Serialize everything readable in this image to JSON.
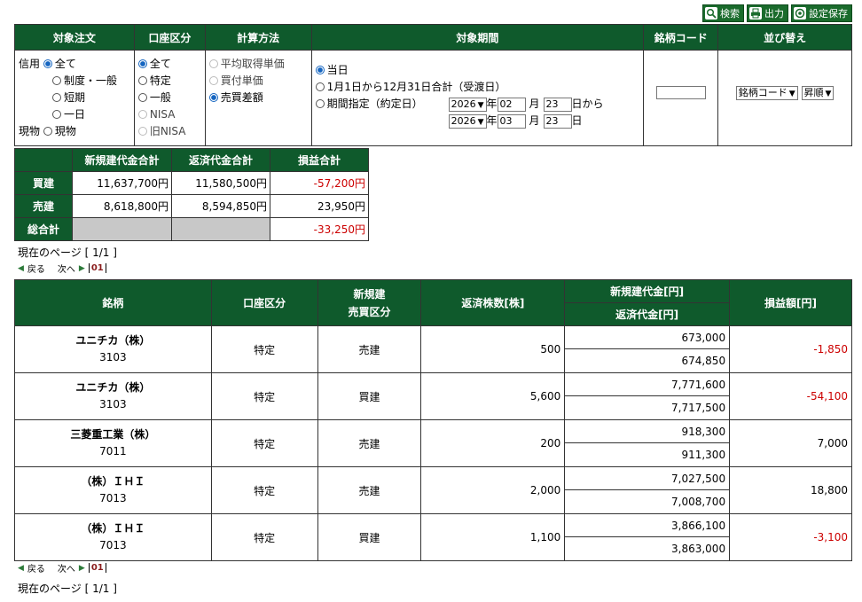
{
  "top_buttons": {
    "search": {
      "label": "検索",
      "icon": "search-icon"
    },
    "output": {
      "label": "出力",
      "icon": "printer-icon"
    },
    "save": {
      "label": "設定保存",
      "icon": "gear-icon"
    }
  },
  "filter": {
    "headers": {
      "order": "対象注文",
      "account": "口座区分",
      "calc": "計算方法",
      "period": "対象期間",
      "code": "銘柄コード",
      "sort": "並び替え"
    },
    "order": {
      "margin_label": "信用",
      "cash_label": "現物",
      "options": [
        "全て",
        "制度・一般",
        "短期",
        "一日",
        "現物"
      ]
    },
    "account": {
      "options": [
        "全て",
        "特定",
        "一般",
        "NISA",
        "旧NISA"
      ]
    },
    "calc": {
      "options": [
        "平均取得単価",
        "買付単価",
        "売買差額"
      ]
    },
    "period": {
      "options": [
        "当日",
        "1月1日から12月31日合計（受渡日）",
        "期間指定（約定日）"
      ],
      "from": {
        "year": "2026",
        "month": "02",
        "day": "23",
        "suffix": "日から"
      },
      "to": {
        "year": "2026",
        "month": "03",
        "day": "23",
        "suffix": "日"
      },
      "year_unit": "年",
      "month_unit": "月"
    },
    "code_value": "",
    "sort": {
      "field": "銘柄コード",
      "order": "昇順"
    }
  },
  "summary": {
    "headers": [
      "新規建代金合計",
      "返済代金合計",
      "損益合計"
    ],
    "rows": [
      {
        "label": "買建",
        "new": "11,637,700円",
        "repay": "11,580,500円",
        "pl": "-57,200円"
      },
      {
        "label": "売建",
        "new": "8,618,800円",
        "repay": "8,594,850円",
        "pl": "23,950円"
      },
      {
        "label": "総合計",
        "new": "",
        "repay": "",
        "pl": "-33,250円"
      }
    ]
  },
  "pagination": {
    "current": "現在のページ [ 1/1 ]",
    "prev": "戻る",
    "next": "次へ",
    "page": "01"
  },
  "table": {
    "headers": {
      "name": "銘柄",
      "account": "口座区分",
      "side_1": "新規建",
      "side_2": "売買区分",
      "qty": "返済株数[株]",
      "new_amt": "新規建代金[円]",
      "repay_amt": "返済代金[円]",
      "pl": "損益額[円]"
    },
    "rows": [
      {
        "name": "ユニチカ（株）",
        "code": "3103",
        "account": "特定",
        "side": "売建",
        "qty": "500",
        "new_amt": "673,000",
        "repay_amt": "674,850",
        "pl": "-1,850"
      },
      {
        "name": "ユニチカ（株）",
        "code": "3103",
        "account": "特定",
        "side": "買建",
        "qty": "5,600",
        "new_amt": "7,771,600",
        "repay_amt": "7,717,500",
        "pl": "-54,100"
      },
      {
        "name": "三菱重工業（株）",
        "code": "7011",
        "account": "特定",
        "side": "売建",
        "qty": "200",
        "new_amt": "918,300",
        "repay_amt": "911,300",
        "pl": "7,000"
      },
      {
        "name": "（株）ＩＨＩ",
        "code": "7013",
        "account": "特定",
        "side": "売建",
        "qty": "2,000",
        "new_amt": "7,027,500",
        "repay_amt": "7,008,700",
        "pl": "18,800"
      },
      {
        "name": "（株）ＩＨＩ",
        "code": "7013",
        "account": "特定",
        "side": "買建",
        "qty": "1,100",
        "new_amt": "3,866,100",
        "repay_amt": "3,863,000",
        "pl": "-3,100"
      }
    ]
  },
  "colors": {
    "header_green": "#0f5a2c",
    "negative": "#cc0000"
  }
}
